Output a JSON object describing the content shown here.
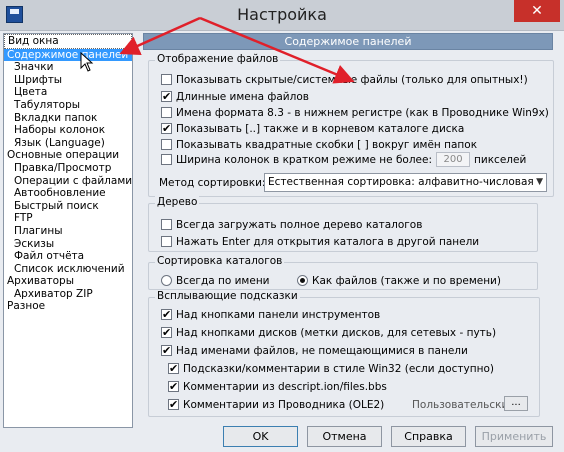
{
  "window": {
    "title": "Настройка",
    "close": "✕"
  },
  "tree": {
    "items": [
      {
        "label": "Вид окна",
        "level": 0
      },
      {
        "label": "Содержимое панелей",
        "level": 0,
        "selected": true
      },
      {
        "label": "Значки",
        "level": 1
      },
      {
        "label": "Шрифты",
        "level": 1
      },
      {
        "label": "Цвета",
        "level": 1
      },
      {
        "label": "Табуляторы",
        "level": 1
      },
      {
        "label": "Вкладки папок",
        "level": 1
      },
      {
        "label": "Наборы колонок",
        "level": 1
      },
      {
        "label": "Язык (Language)",
        "level": 1
      },
      {
        "label": "Основные операции",
        "level": 0
      },
      {
        "label": "Правка/Просмотр",
        "level": 1
      },
      {
        "label": "Операции с файлами",
        "level": 1
      },
      {
        "label": "Автообновление",
        "level": 1
      },
      {
        "label": "Быстрый поиск",
        "level": 1
      },
      {
        "label": "FTP",
        "level": 1
      },
      {
        "label": "Плагины",
        "level": 1
      },
      {
        "label": "Эскизы",
        "level": 1
      },
      {
        "label": "Файл отчёта",
        "level": 1
      },
      {
        "label": "Список исключений",
        "level": 1
      },
      {
        "label": "Архиваторы",
        "level": 0
      },
      {
        "label": "Архиватор ZIP",
        "level": 1
      },
      {
        "label": "Разное",
        "level": 0
      }
    ]
  },
  "header": {
    "title": "Содержимое панелей"
  },
  "file_display": {
    "title": "Отображение файлов",
    "options": [
      {
        "label": "Показывать скрытые/системные файлы (только для опытных!)",
        "checked": false
      },
      {
        "label": "Длинные имена файлов",
        "checked": true
      },
      {
        "label": "Имена формата 8.3 - в нижнем регистре (как в Проводнике Win9x)",
        "checked": false
      },
      {
        "label": "Показывать [..] также и в корневом каталоге диска",
        "checked": true
      },
      {
        "label": "Показывать квадратные скобки [ ] вокруг имён папок",
        "checked": false
      },
      {
        "label": "Ширина колонок в кратком режиме не более:",
        "checked": false
      }
    ],
    "width_value": "200",
    "width_unit": "пикселей",
    "sort_label": "Метод сортировки:",
    "sort_value": "Естественная сортировка: алфавитно-числовая"
  },
  "tree_group": {
    "title": "Дерево",
    "options": [
      {
        "label": "Всегда загружать полное дерево каталогов",
        "checked": false
      },
      {
        "label": "Нажать Enter для открытия каталога в другой панели",
        "checked": false
      }
    ]
  },
  "dir_sort": {
    "title": "Сортировка каталогов",
    "options": [
      {
        "label": "Всегда по имени",
        "checked": false
      },
      {
        "label": "Как файлов (также и по времени)",
        "checked": true
      }
    ]
  },
  "tooltips": {
    "title": "Всплывающие подсказки",
    "options": [
      {
        "label": "Над кнопками панели инструментов",
        "checked": true
      },
      {
        "label": "Над кнопками дисков (метки дисков, для сетевых - путь)",
        "checked": true
      },
      {
        "label": "Над именами файлов, не помещающимися в панели",
        "checked": true
      },
      {
        "label": "Подсказки/комментарии в стиле Win32 (если доступно)",
        "checked": true
      },
      {
        "label": "Комментарии из descript.ion/files.bbs",
        "checked": true
      },
      {
        "label": "Комментарии из Проводника (OLE2)",
        "checked": true
      }
    ],
    "custom_label": "Пользовательские:",
    "custom_button": "..."
  },
  "buttons": {
    "ok": "OK",
    "cancel": "Отмена",
    "help": "Справка",
    "apply": "Применить"
  },
  "colors": {
    "selection": "#3399ff",
    "header": "#7d98b8",
    "close": "#c7302a",
    "annotation_arrow": "#e0202a"
  }
}
